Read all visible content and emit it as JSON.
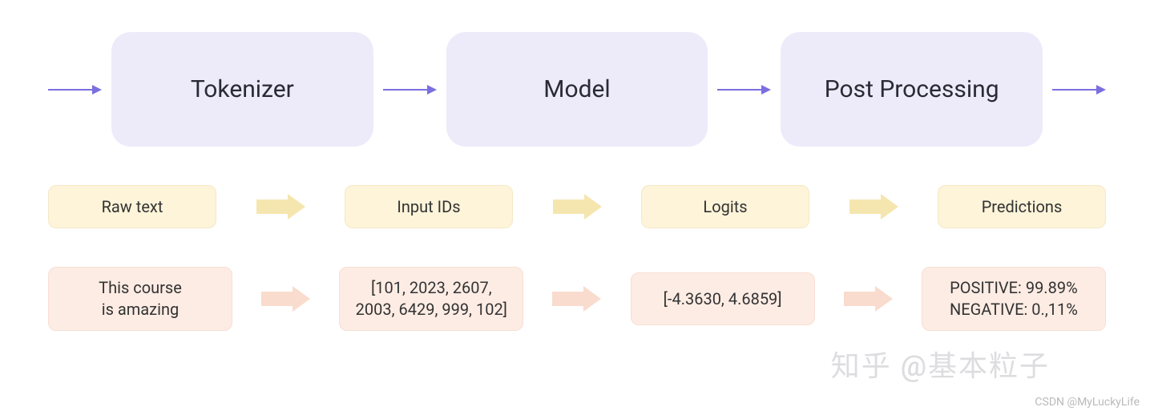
{
  "pipeline": {
    "stages": [
      "Tokenizer",
      "Model",
      "Post Processing"
    ]
  },
  "labels": {
    "raw": "Raw text",
    "input_ids": "Input IDs",
    "logits": "Logits",
    "predictions": "Predictions"
  },
  "examples": {
    "raw": "This course\nis amazing",
    "input_ids": "[101, 2023, 2607,\n2003, 6429, 999, 102]",
    "logits": "[-4.3630, 4.6859]",
    "predictions": "POSITIVE: 99.89%\nNEGATIVE: 0.,11%"
  },
  "watermark": {
    "zhihu": "知乎 @基本粒子",
    "csdn": "CSDN @MyLuckyLife"
  }
}
